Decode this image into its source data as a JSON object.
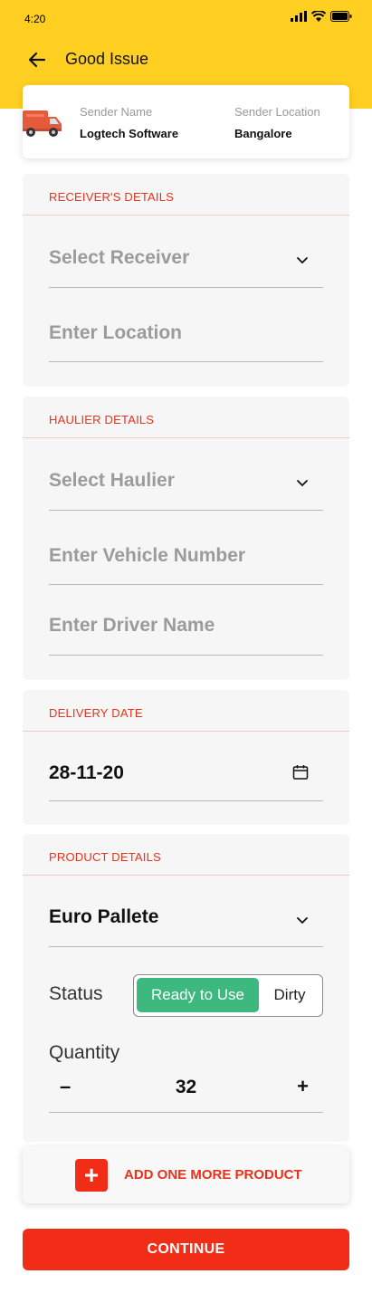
{
  "status_bar": {
    "time": "4:20"
  },
  "header": {
    "title": "Good Issue"
  },
  "sender": {
    "name_label": "Sender Name",
    "name_value": "Logtech Software",
    "location_label": "Sender Location",
    "location_value": "Bangalore"
  },
  "receiver": {
    "title": "RECEIVER'S DETAILS",
    "select_placeholder": "Select Receiver",
    "location_placeholder": "Enter Location"
  },
  "haulier": {
    "title": "HAULIER DETAILS",
    "select_placeholder": "Select Haulier",
    "vehicle_placeholder": "Enter Vehicle Number",
    "driver_placeholder": "Enter Driver Name"
  },
  "delivery": {
    "title": "DELIVERY DATE",
    "date_value": "28-11-20"
  },
  "product": {
    "title": "PRODUCT DETAILS",
    "selected_product": "Euro Pallete",
    "status_label": "Status",
    "status_options": [
      "Ready to Use",
      "Dirty"
    ],
    "status_selected": "Ready to Use",
    "quantity_label": "Quantity",
    "quantity_minus": "–",
    "quantity_value": "32",
    "quantity_plus": "+"
  },
  "actions": {
    "add_icon": "+",
    "add_label": "ADD ONE MORE PRODUCT",
    "continue_label": "CONTINUE"
  },
  "colors": {
    "header_yellow": "#FFCF22",
    "accent_red": "#F22D17",
    "status_green": "#3DB87F"
  },
  "icons": {
    "back": "back-arrow-icon",
    "truck": "truck-icon",
    "dropdown": "chevron-down-icon",
    "calendar": "calendar-icon"
  }
}
